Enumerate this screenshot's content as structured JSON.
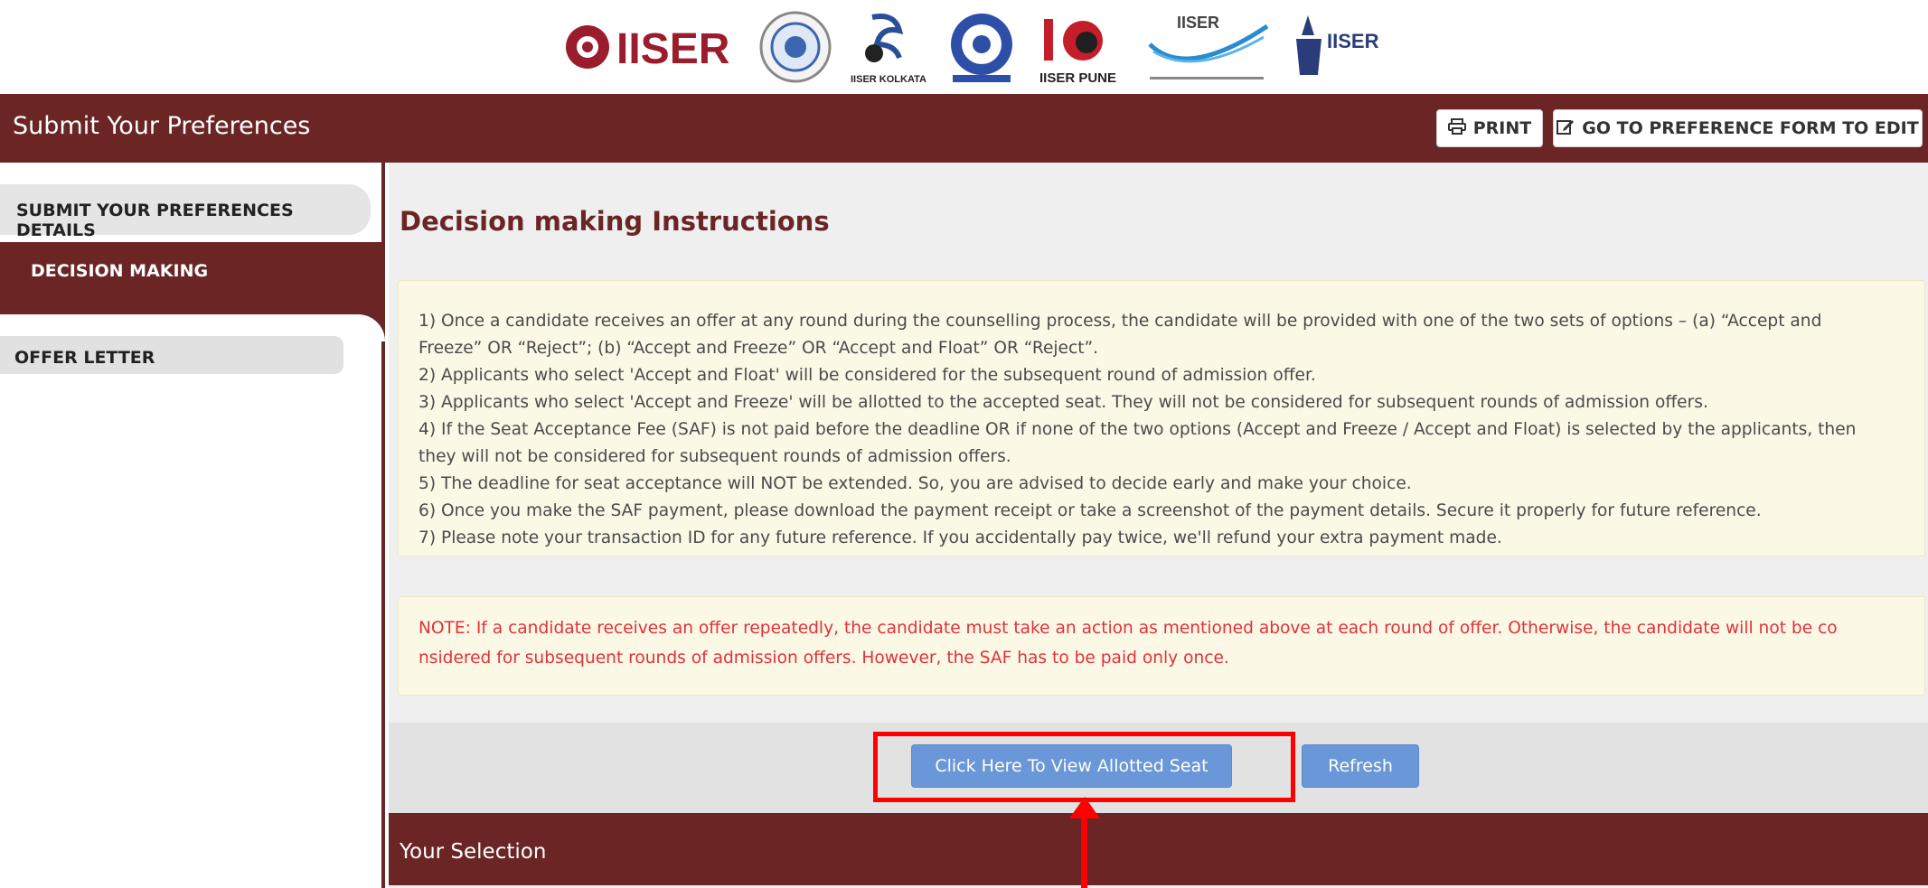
{
  "logos": [
    {
      "name": "iiser-berhampur-logo",
      "text": "IISER"
    },
    {
      "name": "seal-logo-1",
      "text": ""
    },
    {
      "name": "iiser-kolkata-logo",
      "text": "IISER KOLKATA"
    },
    {
      "name": "seal-logo-2",
      "text": ""
    },
    {
      "name": "iiser-pune-logo",
      "text": "IISER PUNE"
    },
    {
      "name": "iiser-tvm-logo",
      "text": "IISER"
    },
    {
      "name": "iiser-tirupati-logo",
      "text": "IISER"
    }
  ],
  "header": {
    "title": "Submit Your Preferences",
    "print_label": "PRINT",
    "edit_label": "GO TO PREFERENCE FORM TO EDIT"
  },
  "sidebar": {
    "items": [
      {
        "label": "SUBMIT YOUR PREFERENCES DETAILS"
      },
      {
        "label": "DECISION MAKING"
      },
      {
        "label": "OFFER LETTER"
      }
    ]
  },
  "main": {
    "title": "Decision making Instructions",
    "instructions": [
      "1) Once a candidate receives an offer at any round during the counselling process, the candidate will be provided with one of the two sets of options – (a) “Accept and",
      "Freeze” OR “Reject”; (b) “Accept and Freeze” OR “Accept and Float” OR “Reject”.",
      "2) Applicants who select 'Accept and Float' will be considered for the subsequent round of admission offer.",
      "3) Applicants who select 'Accept and Freeze' will be allotted to the accepted seat. They will not be considered for subsequent rounds of admission offers.",
      "4) If the Seat Acceptance Fee (SAF) is not paid before the deadline OR if none of the two options (Accept and Freeze / Accept and Float) is selected by the applicants, then",
      "they will not be considered for subsequent rounds of admission offers.",
      "5) The deadline for seat acceptance will NOT be extended. So, you are advised to decide early and make your choice.",
      "6) Once you make the SAF payment, please download the payment receipt or take a screenshot of the payment details. Secure it properly for future reference.",
      "7) Please note your transaction ID for any future reference. If you accidentally pay twice, we'll refund your extra payment made."
    ],
    "note": [
      "NOTE: If a candidate receives an offer repeatedly, the candidate must take an action as mentioned above at each round of offer. Otherwise, the candidate will not be co",
      "nsidered for subsequent rounds of admission offers. However, the SAF has to be paid only once."
    ],
    "view_seat_label": "Click Here To View Allotted Seat",
    "refresh_label": "Refresh",
    "selection_title": "Your Selection"
  },
  "colors": {
    "maroon": "#6b2525",
    "button_blue": "#6a97d7",
    "note_red": "#e0323a",
    "highlight_red": "#ff0000"
  }
}
